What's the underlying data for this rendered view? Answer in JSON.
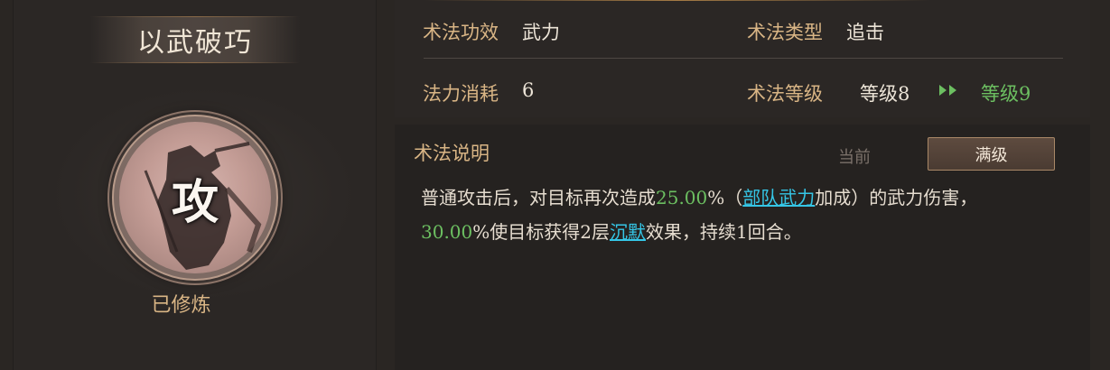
{
  "skill": {
    "name": "以武破巧",
    "emblem_char": "攻",
    "status": "已修炼"
  },
  "attributes": {
    "effect_label": "术法功效",
    "effect_value": "武力",
    "type_label": "术法类型",
    "type_value": "追击",
    "cost_label": "法力消耗",
    "cost_value": "6",
    "level_label": "术法等级",
    "level_current": "等级8",
    "level_next": "等级9"
  },
  "description": {
    "title": "术法说明",
    "tab_current": "当前",
    "tab_max": "满级",
    "line1_a": "普通攻击后，对目标再次造成",
    "line1_pct": "25.00",
    "line1_b": "%（",
    "line1_link": "部队武力",
    "line1_c": "加成）的武力伤害，",
    "line2_pct": "30.00",
    "line2_a": "%使目标获得2层",
    "line2_link": "沉默",
    "line2_b": "效果，持续1回合。"
  },
  "colors": {
    "label_gold": "#d9b585",
    "value_light": "#ece4d7",
    "highlight_green": "#6cbf61",
    "link_cyan": "#35c6e6"
  },
  "icons": {
    "level_arrow": "double-chevron-right-icon"
  }
}
